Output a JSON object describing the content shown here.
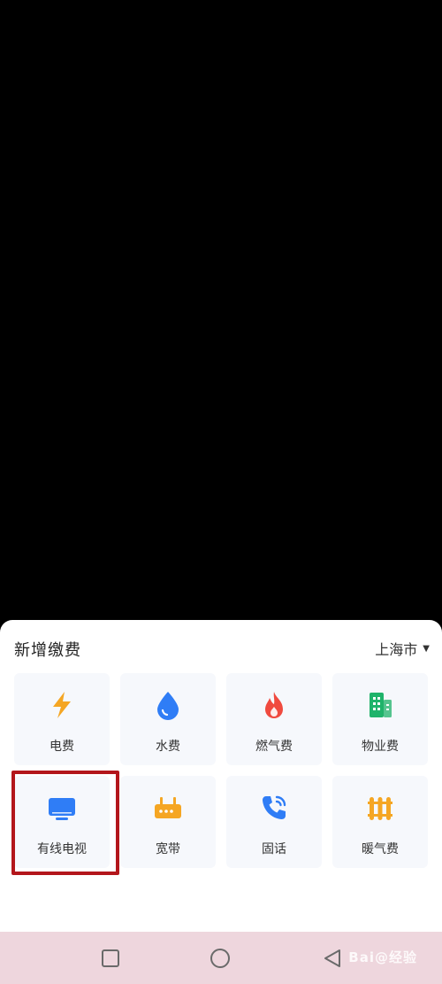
{
  "sheet": {
    "title": "新增缴费",
    "city": "上海市"
  },
  "tiles": [
    {
      "label": "电费",
      "icon": "lightning-icon",
      "color": "#f5a623"
    },
    {
      "label": "水费",
      "icon": "water-drop-icon",
      "color": "#2f7df6"
    },
    {
      "label": "燃气费",
      "icon": "flame-icon",
      "color": "#f04a3f"
    },
    {
      "label": "物业费",
      "icon": "building-icon",
      "color": "#1fb36a"
    },
    {
      "label": "有线电视",
      "icon": "tv-icon",
      "color": "#2f7df6"
    },
    {
      "label": "宽带",
      "icon": "router-icon",
      "color": "#f5a623"
    },
    {
      "label": "固话",
      "icon": "phone-icon",
      "color": "#2f7df6"
    },
    {
      "label": "暖气费",
      "icon": "radiator-icon",
      "color": "#f5a623"
    }
  ],
  "highlight_color": "#b3161b",
  "navbar": {
    "watermark": "Bai@经验"
  }
}
